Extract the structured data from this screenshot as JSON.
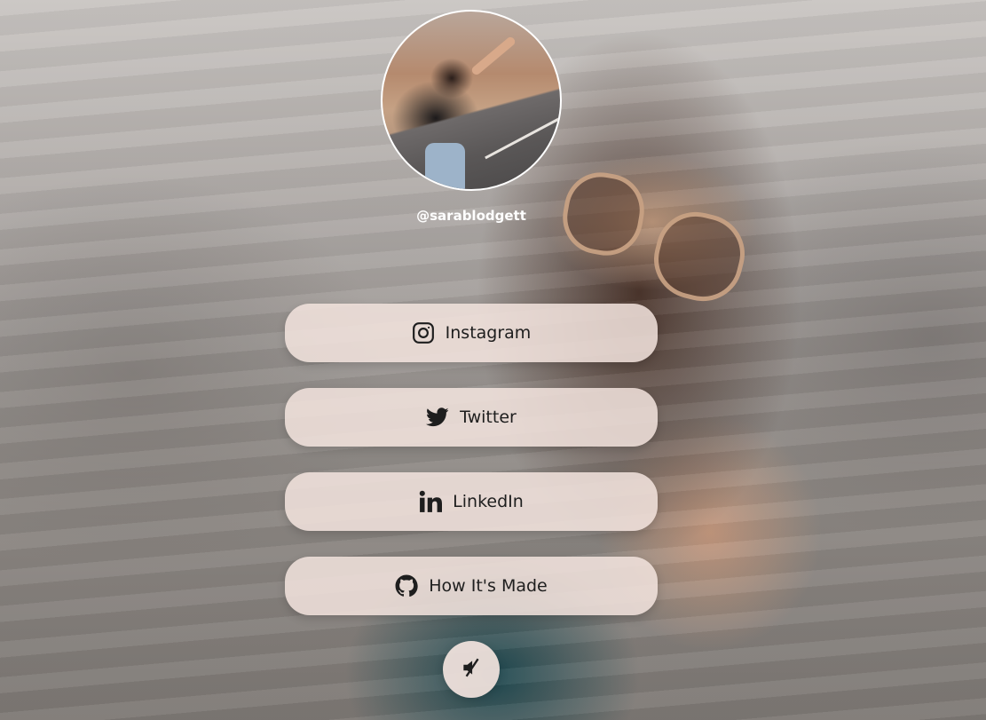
{
  "profile": {
    "username": "@sarablodgett"
  },
  "links": [
    {
      "label": "Instagram",
      "icon": "instagram-icon"
    },
    {
      "label": "Twitter",
      "icon": "twitter-icon"
    },
    {
      "label": "LinkedIn",
      "icon": "linkedin-icon"
    },
    {
      "label": "How It's Made",
      "icon": "github-icon"
    }
  ],
  "controls": {
    "mute_icon": "volume-muted-icon"
  },
  "colors": {
    "button_bg": "#f3e4de",
    "button_text": "#1e1e1e",
    "username_text": "#ffffff"
  }
}
